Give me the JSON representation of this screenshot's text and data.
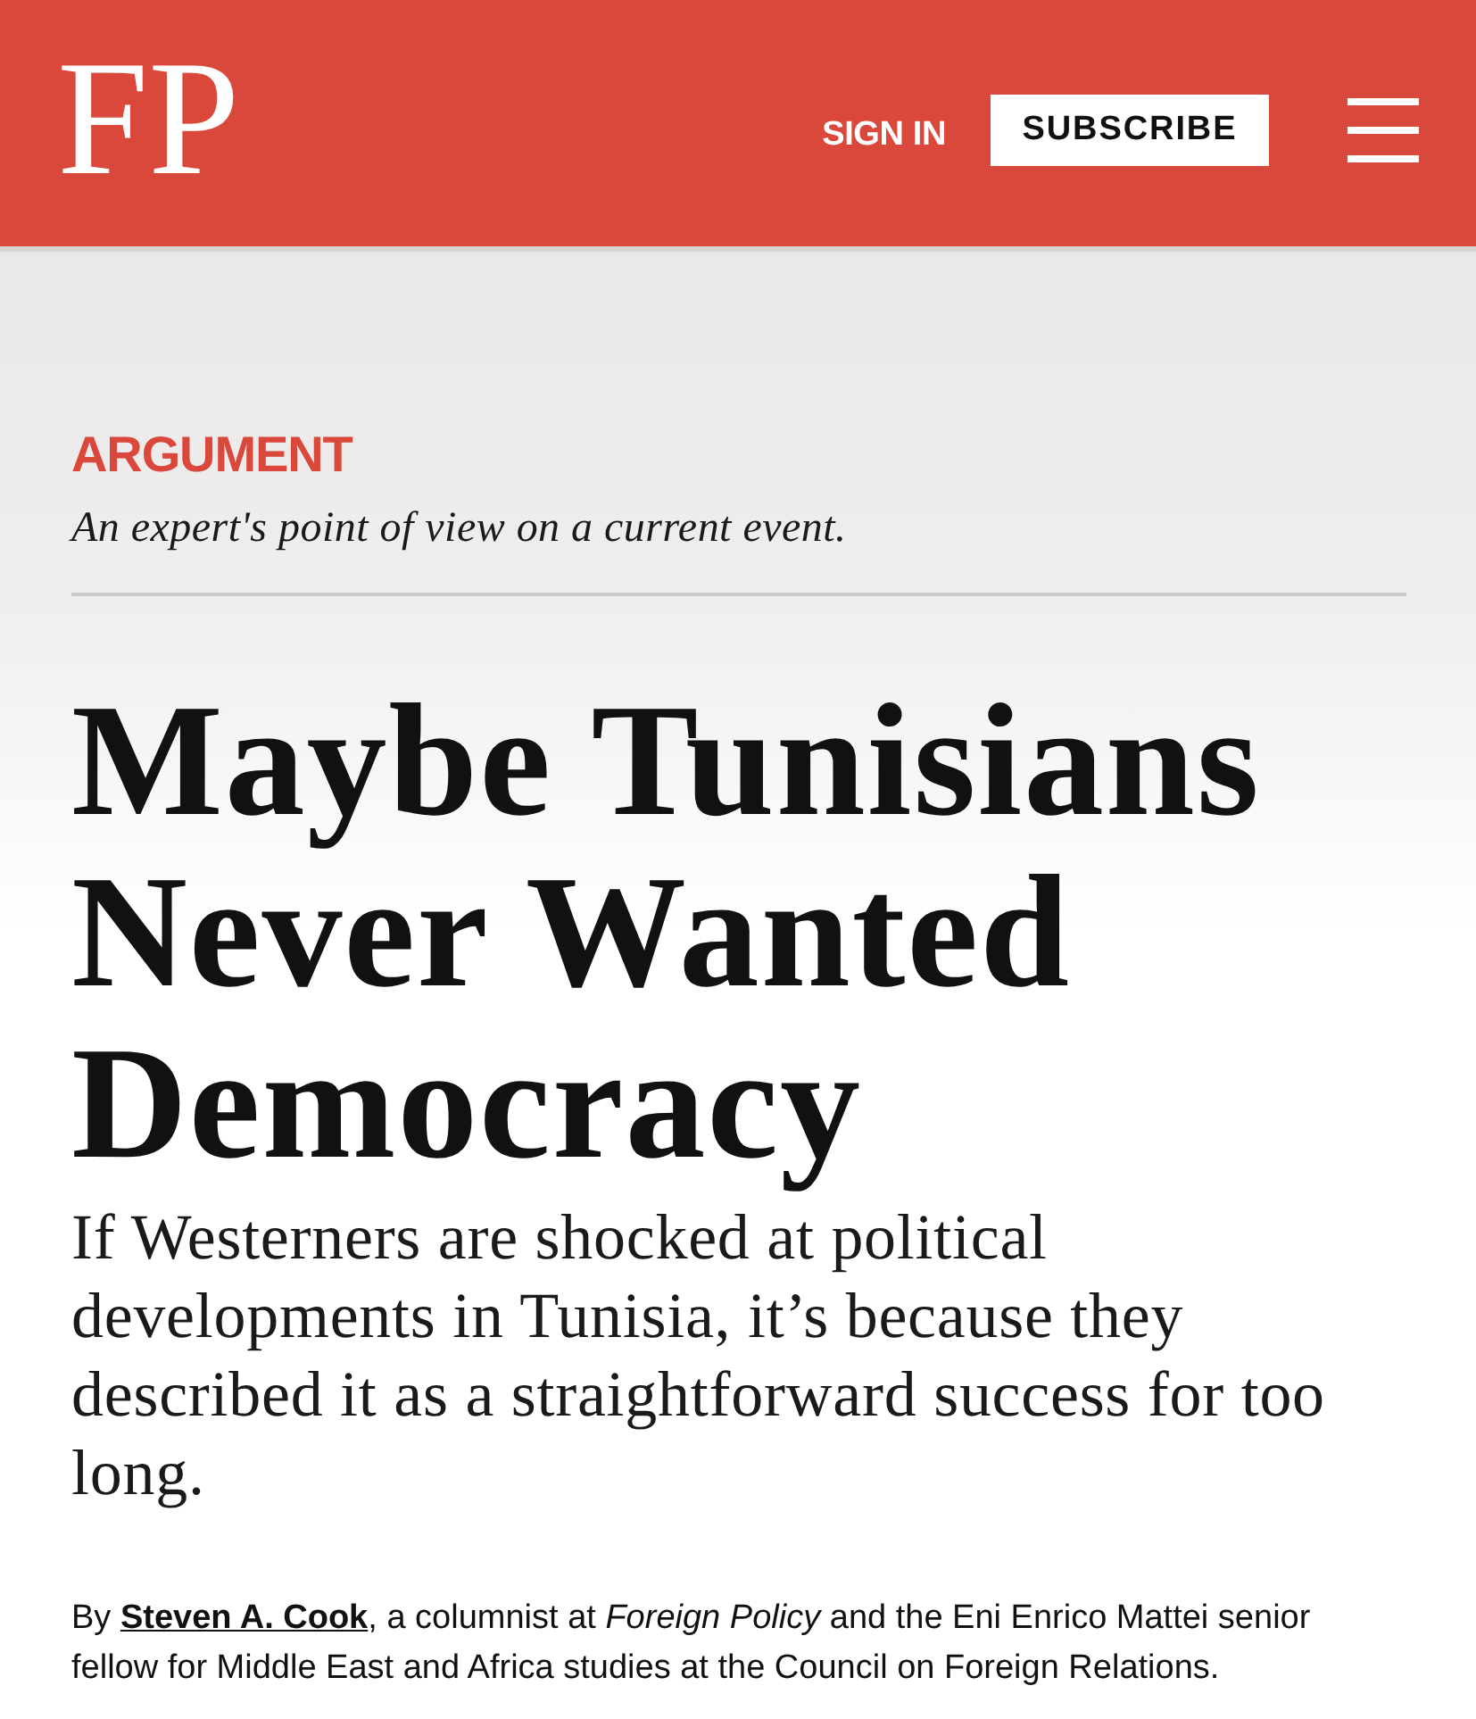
{
  "header": {
    "logo": "FP",
    "sign_in": "SIGN IN",
    "subscribe": "SUBSCRIBE"
  },
  "article": {
    "section": "ARGUMENT",
    "section_description": "An expert's point of view on a current event.",
    "headline": "Maybe Tunisians Never Wanted Democracy",
    "dek": "If Westerners are shocked at political developments in Tunisia, it’s because they described it as a straightforward success for too long.",
    "byline": {
      "prefix": "By",
      "author": "Steven A. Cook",
      "suffix": ", a columnist at *Foreign Policy* and the Eni Enrico Mattei senior fellow for Middle East and Africa studies at the Council on Foreign Relations."
    }
  }
}
